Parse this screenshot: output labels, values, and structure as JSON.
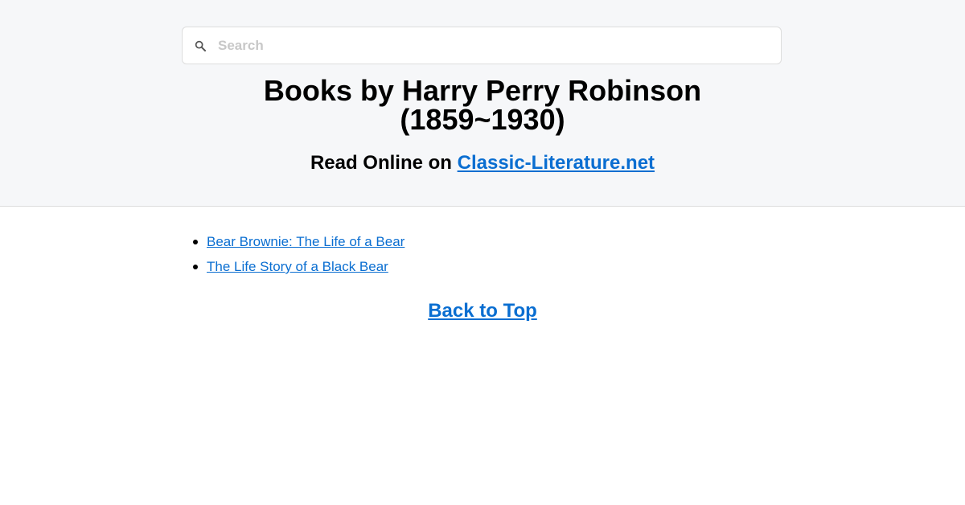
{
  "search": {
    "placeholder": "Search",
    "value": "",
    "icon": "search-icon"
  },
  "title": {
    "line1": "Books by Harry Perry Robinson",
    "line2": "(1859~1930)"
  },
  "subtitle": {
    "prefix": "Read Online on ",
    "link_text": "Classic-Literature.net"
  },
  "books": [
    {
      "title": "Bear Brownie: The Life of a Bear"
    },
    {
      "title": "The Life Story of a Black Bear"
    }
  ],
  "back_to_top": "Back to Top",
  "colors": {
    "link": "#0a6ed1",
    "header_bg": "#f6f7f9",
    "text": "#000000"
  }
}
